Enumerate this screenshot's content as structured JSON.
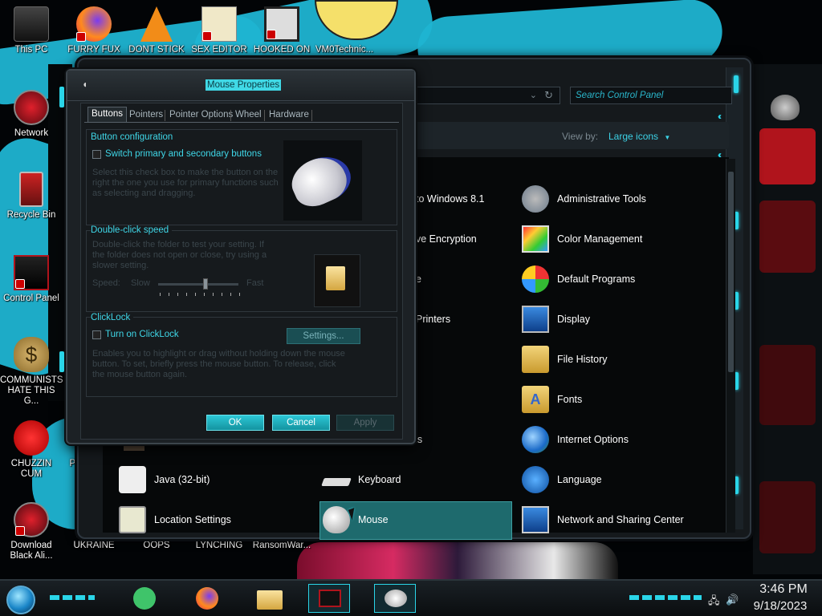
{
  "desktop_icons": [
    {
      "label": "This PC"
    },
    {
      "label": "FURRY FUX"
    },
    {
      "label": "DONT STICK"
    },
    {
      "label": "SEX EDITOR"
    },
    {
      "label": "HOOKED ON"
    },
    {
      "label": "VM0Technic..."
    },
    {
      "label": "Network"
    },
    {
      "label": "Recycle Bin"
    },
    {
      "label": "Control Panel"
    },
    {
      "label": "COMMUNISTS HATE THIS G..."
    },
    {
      "label": "CHUZZIN CUM"
    },
    {
      "label": "Plar Zo"
    },
    {
      "label": "Download Black Ali..."
    },
    {
      "label": "UKRAINE"
    },
    {
      "label": "OOPS"
    },
    {
      "label": "LYNCHING"
    },
    {
      "label": "RansomWar..."
    }
  ],
  "control_panel": {
    "search_placeholder": "Search Control Panel",
    "view_by_label": "View by:",
    "view_by_value": "Large icons",
    "view_by_arrow": "▼",
    "col1_items": [
      {
        "label": "Java (32-bit)",
        "icon": "java-icon"
      },
      {
        "label": "Location Settings",
        "icon": "location-icon"
      }
    ],
    "col2_items": [
      {
        "label": "to Windows 8.1",
        "icon": "windows-icon"
      },
      {
        "label": "ve Encryption",
        "icon": "encryption-icon"
      },
      {
        "label": "e",
        "icon": "generic-icon"
      },
      {
        "label": "Printers",
        "icon": "printer-icon"
      },
      {
        "label": "ons",
        "icon": "generic-icon"
      },
      {
        "label": "Keyboard",
        "icon": "keyboard-icon"
      },
      {
        "label": "Mouse",
        "icon": "mouse-icon"
      }
    ],
    "col3_items": [
      {
        "label": "Administrative Tools",
        "icon": "admin-tools-icon"
      },
      {
        "label": "Color Management",
        "icon": "color-management-icon"
      },
      {
        "label": "Default Programs",
        "icon": "default-programs-icon"
      },
      {
        "label": "Display",
        "icon": "display-icon"
      },
      {
        "label": "File History",
        "icon": "file-history-icon"
      },
      {
        "label": "Fonts",
        "icon": "fonts-icon"
      },
      {
        "label": "Internet Options",
        "icon": "internet-options-icon"
      },
      {
        "label": "Language",
        "icon": "language-icon"
      },
      {
        "label": "Network and Sharing Center",
        "icon": "network-sharing-icon"
      }
    ],
    "selected_item": "Mouse"
  },
  "dialog": {
    "title": "Mouse Properties",
    "tabs": [
      "Buttons",
      "Pointers",
      "Pointer Options",
      "Wheel",
      "Hardware"
    ],
    "active_tab": "Buttons",
    "button_config": {
      "title": "Button configuration",
      "checkbox_label": "Switch primary and secondary buttons",
      "description": "Select this check box to make the button on the right the one you use for primary functions such as selecting and dragging."
    },
    "double_click": {
      "title": "Double-click speed",
      "description": "Double-click the folder to test your setting. If the folder does not open or close, try using a slower setting.",
      "speed_label": "Speed:",
      "slow_label": "Slow",
      "fast_label": "Fast"
    },
    "clicklock": {
      "title": "ClickLock",
      "checkbox_label": "Turn on ClickLock",
      "settings_button": "Settings...",
      "description": "Enables you to highlight or drag without holding down the mouse button. To set, briefly press the mouse button. To release, click the mouse button again."
    },
    "buttons": {
      "ok": "OK",
      "cancel": "Cancel",
      "apply": "Apply"
    }
  },
  "taskbar": {
    "time": "3:46 PM",
    "date": "9/18/2023"
  },
  "colors": {
    "accent": "#2ad5e8",
    "selection": "#1e6a6d",
    "wallpaper_streak": "#1fb4d2",
    "alienware_red": "#b0141c"
  }
}
